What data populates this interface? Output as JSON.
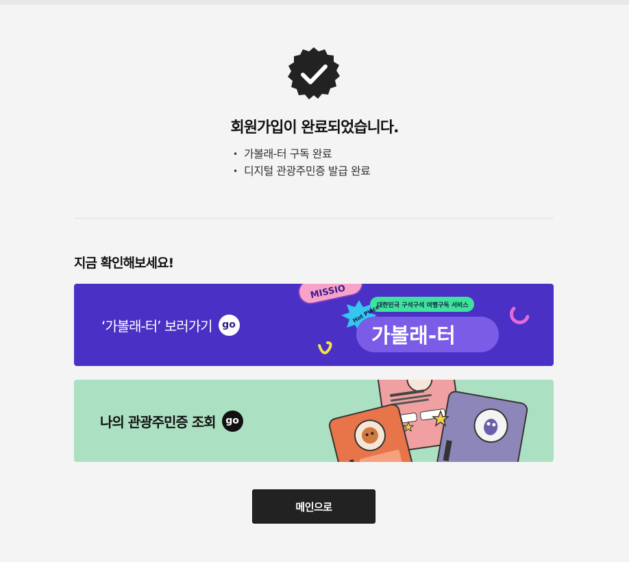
{
  "confirmation": {
    "title": "회원가입이 완료되었습니다.",
    "items": [
      "가볼래-터 구독 완료",
      "디지털 관광주민증 발급 완료"
    ]
  },
  "section": {
    "title": "지금 확인해보세요!"
  },
  "banners": [
    {
      "label": "‘가볼래-터’ 보러가기",
      "go": "go",
      "art": {
        "mission_text": "MISSIO",
        "hot_place_text": "Hot Place",
        "tagline": "대한민국 구석구석 여행구독 서비스",
        "logo_text": "가볼래-터"
      }
    },
    {
      "label": "나의 관광주민증 조회",
      "go": "go"
    }
  ],
  "main_button": {
    "label": "메인으로"
  },
  "colors": {
    "purple_banner": "#4a30c4",
    "green_banner": "#ace0c2",
    "badge": "#222222",
    "button": "#222222"
  }
}
